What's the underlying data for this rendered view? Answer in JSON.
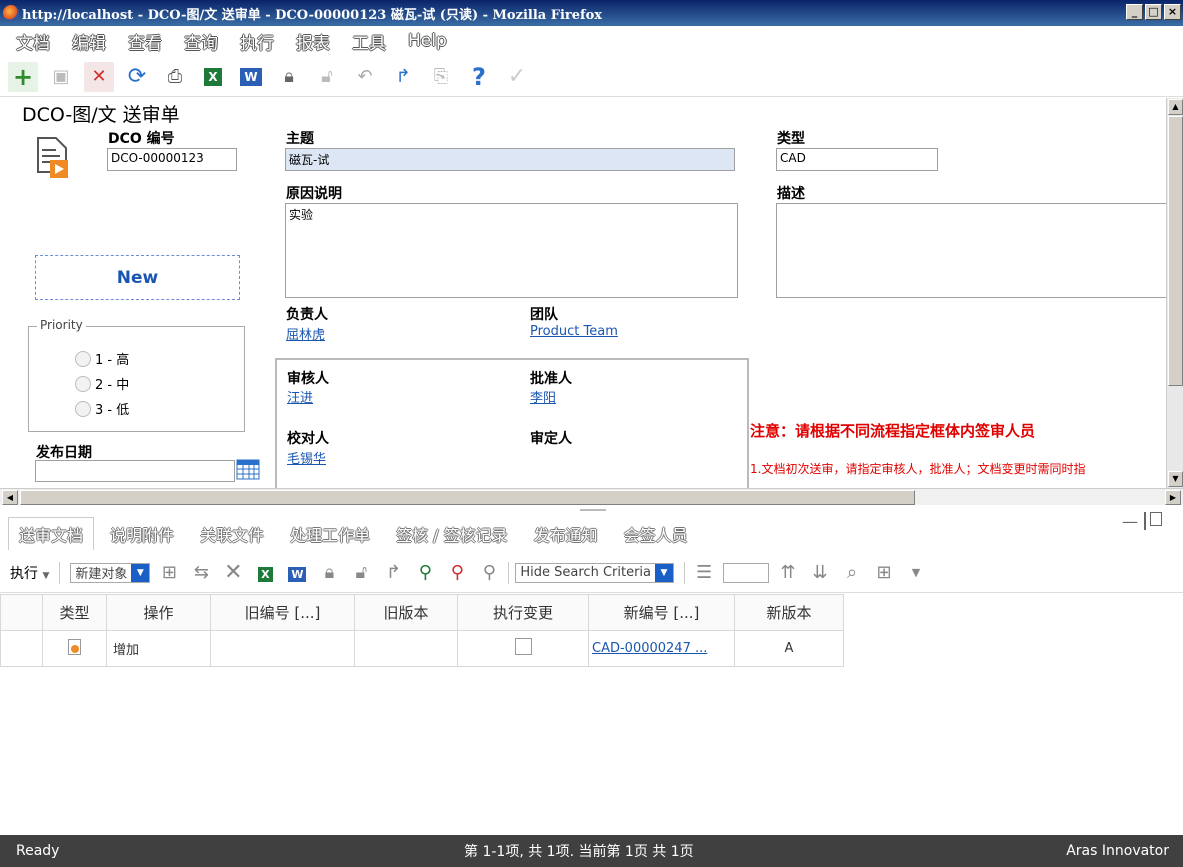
{
  "window": {
    "title": "http://localhost - DCO-图/文 送审单 - DCO-00000123 磁瓦-试 (只读) - Mozilla Firefox"
  },
  "menu": [
    "文档",
    "编辑",
    "查看",
    "查询",
    "执行",
    "报表",
    "工具",
    "Help"
  ],
  "form": {
    "heading": "DCO-图/文 送审单",
    "dco_label": "DCO 编号",
    "dco_value": "DCO-00000123",
    "subject_label": "主题",
    "subject_value": "磁瓦-试",
    "type_label": "类型",
    "type_value": "CAD",
    "reason_label": "原因说明",
    "reason_value": "实验",
    "desc_label": "描述",
    "state": "New",
    "priority_legend": "Priority",
    "priority_options": [
      "1 - 高",
      "2 - 中",
      "3 - 低"
    ],
    "release_date_label": "发布日期",
    "owner_label": "负责人",
    "owner_value": "屈林虎",
    "team_label": "团队",
    "team_value": "Product Team",
    "reviewer_label": "审核人",
    "reviewer_value": "汪进",
    "approver_label": "批准人",
    "approver_value": "李阳",
    "checker_label": "校对人",
    "checker_value": "毛锡华",
    "finalizer_label": "审定人",
    "notice_title": "注意：请根据不同流程指定框体内签审人员",
    "notice_line1": "1.文档初次送审，请指定审核人，批准人；文档变更时需同时指"
  },
  "tabs": [
    "送审文档",
    "说明附件",
    "关联文件",
    "处理工作单",
    "签核 / 签核记录",
    "发布通知",
    "会签人员"
  ],
  "gridbar": {
    "exec_label": "执行",
    "new_object": "新建对象",
    "hide_search": "Hide Search Criteria"
  },
  "grid": {
    "headers": [
      "类型",
      "操作",
      "旧编号 [...]",
      "旧版本",
      "执行变更",
      "新编号 [...]",
      "新版本"
    ],
    "rows": [
      {
        "action": "增加",
        "old_no": "",
        "old_ver": "",
        "new_no": "CAD-00000247 ...",
        "new_ver": "A"
      }
    ]
  },
  "status": {
    "left": "Ready",
    "center": "第 1-1项, 共 1项. 当前第 1页 共 1页",
    "right": "Aras Innovator"
  }
}
